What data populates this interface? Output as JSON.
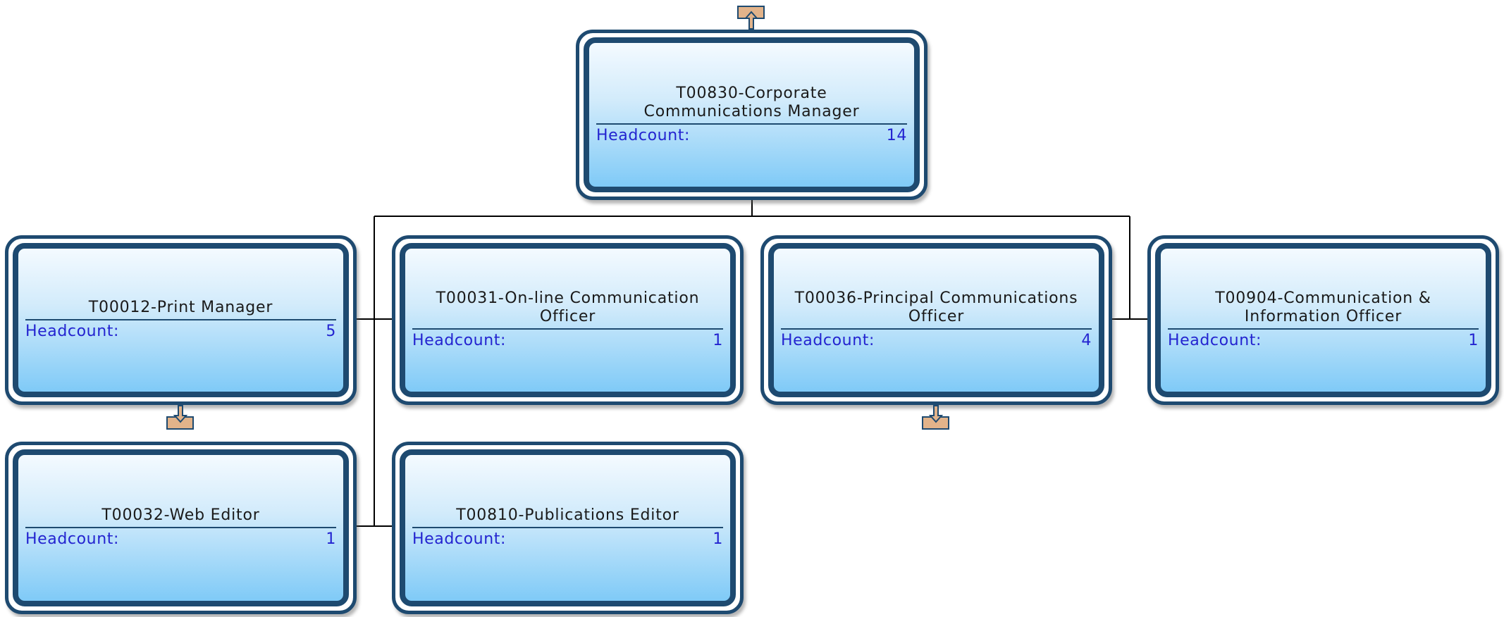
{
  "nodes": [
    {
      "id": "root",
      "title_line1": "T00830-Corporate",
      "title_line2": "Communications Manager",
      "headcount_label": "Headcount:",
      "headcount": "14"
    },
    {
      "id": "print",
      "title_line1": "T00012-Print Manager",
      "title_line2": "",
      "headcount_label": "Headcount:",
      "headcount": "5"
    },
    {
      "id": "online",
      "title_line1": "T00031-On-line Communication",
      "title_line2": "Officer",
      "headcount_label": "Headcount:",
      "headcount": "1"
    },
    {
      "id": "principal",
      "title_line1": "T00036-Principal Communications",
      "title_line2": "Officer",
      "headcount_label": "Headcount:",
      "headcount": "4"
    },
    {
      "id": "info",
      "title_line1": "T00904-Communication &",
      "title_line2": "Information Officer",
      "headcount_label": "Headcount:",
      "headcount": "1"
    },
    {
      "id": "web",
      "title_line1": "T00032-Web Editor",
      "title_line2": "",
      "headcount_label": "Headcount:",
      "headcount": "1"
    },
    {
      "id": "pubs",
      "title_line1": "T00810-Publications Editor",
      "title_line2": "",
      "headcount_label": "Headcount:",
      "headcount": "1"
    }
  ],
  "colors": {
    "border": "#1e4a70",
    "headcount_text": "#2323d0",
    "arrow_fill": "#e2b38a",
    "arrow_stroke": "#1e4a70",
    "connector": "#000000"
  },
  "icons": [
    "expand-up-arrow-icon",
    "expand-down-arrow-icon"
  ]
}
